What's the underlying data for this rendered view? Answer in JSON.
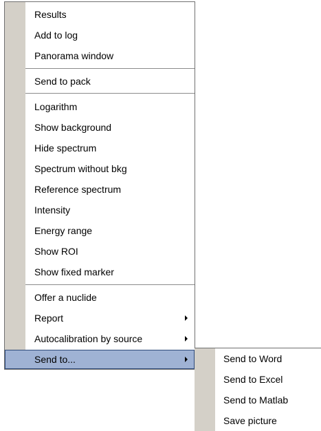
{
  "menu": {
    "items": [
      {
        "label": "Results"
      },
      {
        "label": "Add to log"
      },
      {
        "label": "Panorama window"
      },
      {
        "label": "Send to pack"
      },
      {
        "label": "Logarithm"
      },
      {
        "label": "Show background"
      },
      {
        "label": "Hide spectrum"
      },
      {
        "label": "Spectrum without bkg"
      },
      {
        "label": "Reference spectrum"
      },
      {
        "label": "Intensity"
      },
      {
        "label": "Energy range"
      },
      {
        "label": "Show ROI"
      },
      {
        "label": "Show fixed marker"
      },
      {
        "label": "Offer a nuclide"
      },
      {
        "label": "Report"
      },
      {
        "label": "Autocalibration by source"
      },
      {
        "label": "Send to..."
      }
    ],
    "highlighted_item": "Send to..."
  },
  "submenu": {
    "items": [
      {
        "label": "Send to Word"
      },
      {
        "label": "Send to Excel"
      },
      {
        "label": "Send to Matlab"
      },
      {
        "label": "Save picture"
      }
    ]
  },
  "icons": {
    "submenu_arrow": "chevron-right-icon"
  },
  "colors": {
    "gutter": "#d4d0c8",
    "highlight_bg": "#9fb2d4",
    "highlight_border": "#2e4a7a",
    "menu_border": "#6f6f6f",
    "separator": "#8a8a8a"
  }
}
